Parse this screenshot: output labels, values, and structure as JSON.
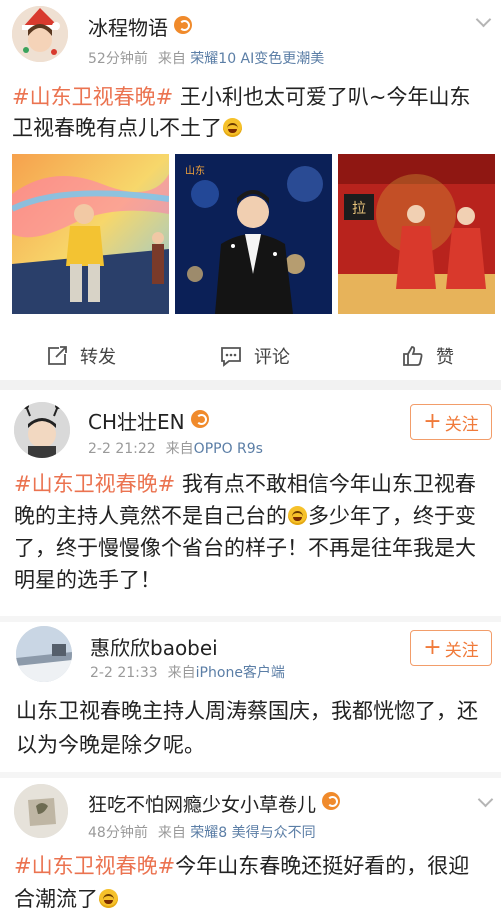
{
  "post1": {
    "author": "冰程物语",
    "time": "52分钟前",
    "source_prefix": "来自",
    "source": "荣耀10 AI变色更潮美",
    "topic": "#山东卫视春晚#",
    "text": " 王小利也太可爱了叭~今年山东卫视春晚有点儿不土了",
    "actions": {
      "repost": "转发",
      "comment": "评论",
      "like": "赞"
    }
  },
  "comment1": {
    "author": "CH壮壮EN",
    "time": "2-2 21:22",
    "source_prefix": "来自",
    "source": "OPPO R9s",
    "follow_label": "关注",
    "topic": "#山东卫视春晚#",
    "text_a": " 我有点不敢相信今年山东卫视春晚的主持人竟然不是自己台的",
    "text_b": "多少年了，终于变了，终于慢慢像个省台的样子！不再是往年我是大明星的选手了！"
  },
  "comment2": {
    "author": "惠欣欣baobei",
    "time": "2-2 21:33",
    "source_prefix": "来自",
    "source": "iPhone客户端",
    "follow_label": "关注",
    "text": "山东卫视春晚主持人周涛蔡国庆，我都恍惚了，还以为今晚是除夕呢。"
  },
  "comment3": {
    "author": "狂吃不怕网瘾少女小草卷儿",
    "time": "48分钟前",
    "source_prefix": "来自",
    "source": "荣耀8 美得与众不同",
    "topic": "#山东卫视春晚#",
    "text": "今年山东春晚还挺好看的，很迎合潮流了"
  },
  "photos": {
    "p2_badge": "山东",
    "p3_sign": "拉"
  },
  "colors": {
    "accent": "#eb7350",
    "link": "#5b7ea6",
    "follow": "#f07a3a"
  }
}
